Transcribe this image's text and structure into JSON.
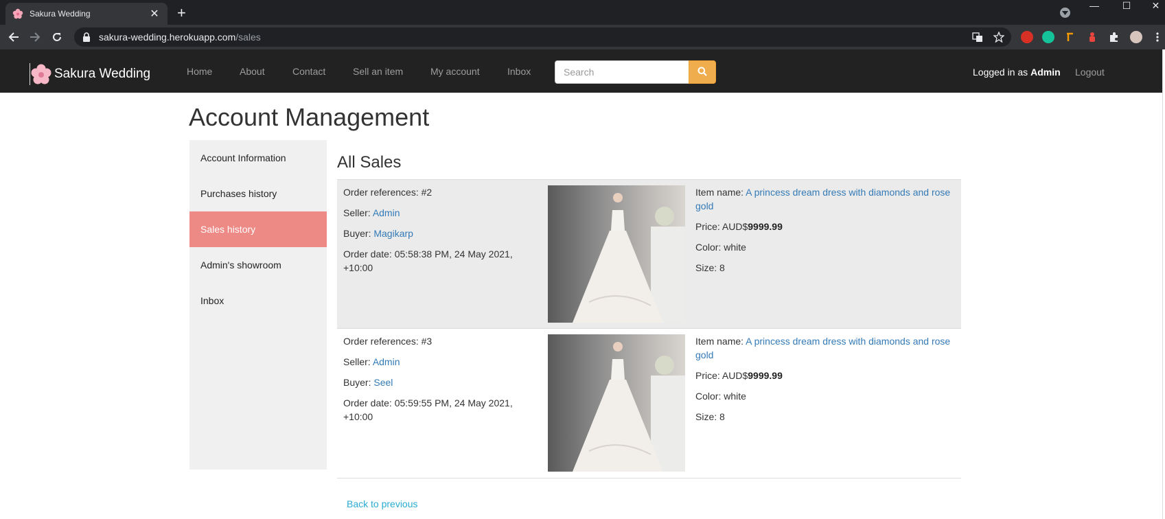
{
  "browser": {
    "tab_title": "Sakura Wedding",
    "tab_close": "✕",
    "new_tab": "+",
    "url_host": "sakura-wedding.herokuapp.com",
    "url_path": "/sales",
    "win_minimize": "—",
    "win_maximize": "☐",
    "win_close": "✕"
  },
  "site": {
    "brand": "Sakura Wedding",
    "nav": [
      "Home",
      "About",
      "Contact",
      "Sell an item",
      "My account",
      "Inbox"
    ],
    "search_placeholder": "Search",
    "logged_prefix": "Logged in as ",
    "logged_user": "Admin",
    "logout_icon": "",
    "logout": "Logout"
  },
  "page": {
    "title": "Account Management",
    "sidebar": [
      "Account Information",
      "Purchases history",
      "Sales history",
      "Admin's showroom",
      "Inbox"
    ],
    "active_sidebar": "Sales history",
    "section_title": "All Sales",
    "back_link": "Back to previous"
  },
  "labels": {
    "order_ref": "Order references: ",
    "seller": "Seller: ",
    "buyer": "Buyer: ",
    "order_date": "Order date: ",
    "item_name": "Item name: ",
    "price": "Price: ",
    "currency": "AUD$",
    "color": "Color: ",
    "size": "Size: "
  },
  "orders": [
    {
      "ref": "#2",
      "seller": "Admin",
      "buyer": "Magikarp",
      "date": "05:58:38 PM, 24 May 2021, +10:00",
      "item_name": "A princess dream dress with diamonds and rose gold",
      "price": "9999.99",
      "color": "white",
      "size": "8"
    },
    {
      "ref": "#3",
      "seller": "Admin",
      "buyer": "Seel",
      "date": "05:59:55 PM, 24 May 2021, +10:00",
      "item_name": "A princess dream dress with diamonds and rose gold",
      "price": "9999.99",
      "color": "white",
      "size": "8"
    }
  ],
  "colors": {
    "navbar": "#222222",
    "active_sidebar": "#ee8a85",
    "search_button": "#f0ad4e",
    "link": "#337ab7"
  }
}
